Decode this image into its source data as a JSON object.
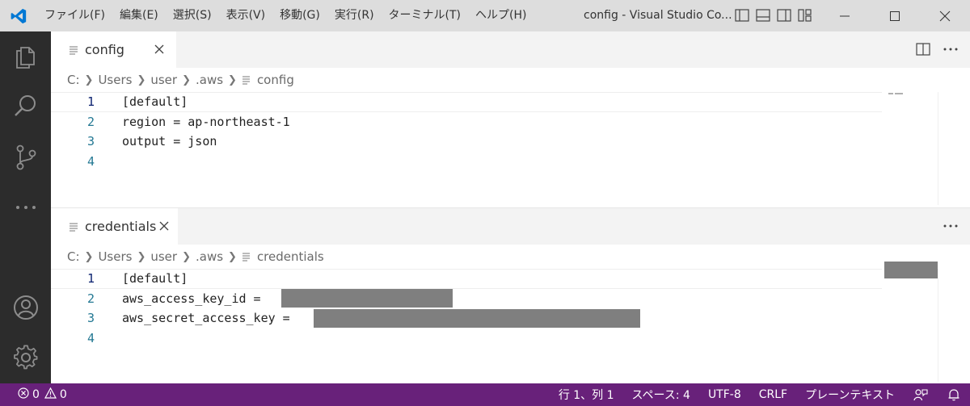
{
  "titlebar": {
    "menu": [
      "ファイル(F)",
      "編集(E)",
      "選択(S)",
      "表示(V)",
      "移動(G)",
      "実行(R)",
      "ターミナル(T)",
      "ヘルプ(H)"
    ],
    "window_title": "config - Visual Studio Co..."
  },
  "editor_top": {
    "tab_label": "config",
    "breadcrumb": [
      "C:",
      "Users",
      "user",
      ".aws",
      "config"
    ],
    "lines": [
      {
        "number": "1",
        "text": "[default]"
      },
      {
        "number": "2",
        "text": "region = ap-northeast-1"
      },
      {
        "number": "3",
        "text": "output = json"
      },
      {
        "number": "4",
        "text": ""
      }
    ]
  },
  "editor_bottom": {
    "tab_label": "credentials",
    "breadcrumb": [
      "C:",
      "Users",
      "user",
      ".aws",
      "credentials"
    ],
    "lines": [
      {
        "number": "1",
        "text": "[default]"
      },
      {
        "number": "2",
        "text": "aws_access_key_id = "
      },
      {
        "number": "3",
        "text": "aws_secret_access_key = "
      },
      {
        "number": "4",
        "text": ""
      }
    ]
  },
  "statusbar": {
    "errors": "0",
    "warnings": "0",
    "position": "行 1、列 1",
    "spaces": "スペース: 4",
    "encoding": "UTF-8",
    "eol": "CRLF",
    "language": "プレーンテキスト"
  },
  "colors": {
    "statusbar": "#68217a",
    "activitybar": "#2c2c2c",
    "titlebar": "#dddddd",
    "vscode_blue": "#0078d4",
    "redaction": "#7f7f7f"
  },
  "icons": {
    "activity": [
      "explorer-icon",
      "search-icon",
      "source-control-icon",
      "more-icon",
      "account-icon",
      "settings-gear-icon"
    ]
  }
}
